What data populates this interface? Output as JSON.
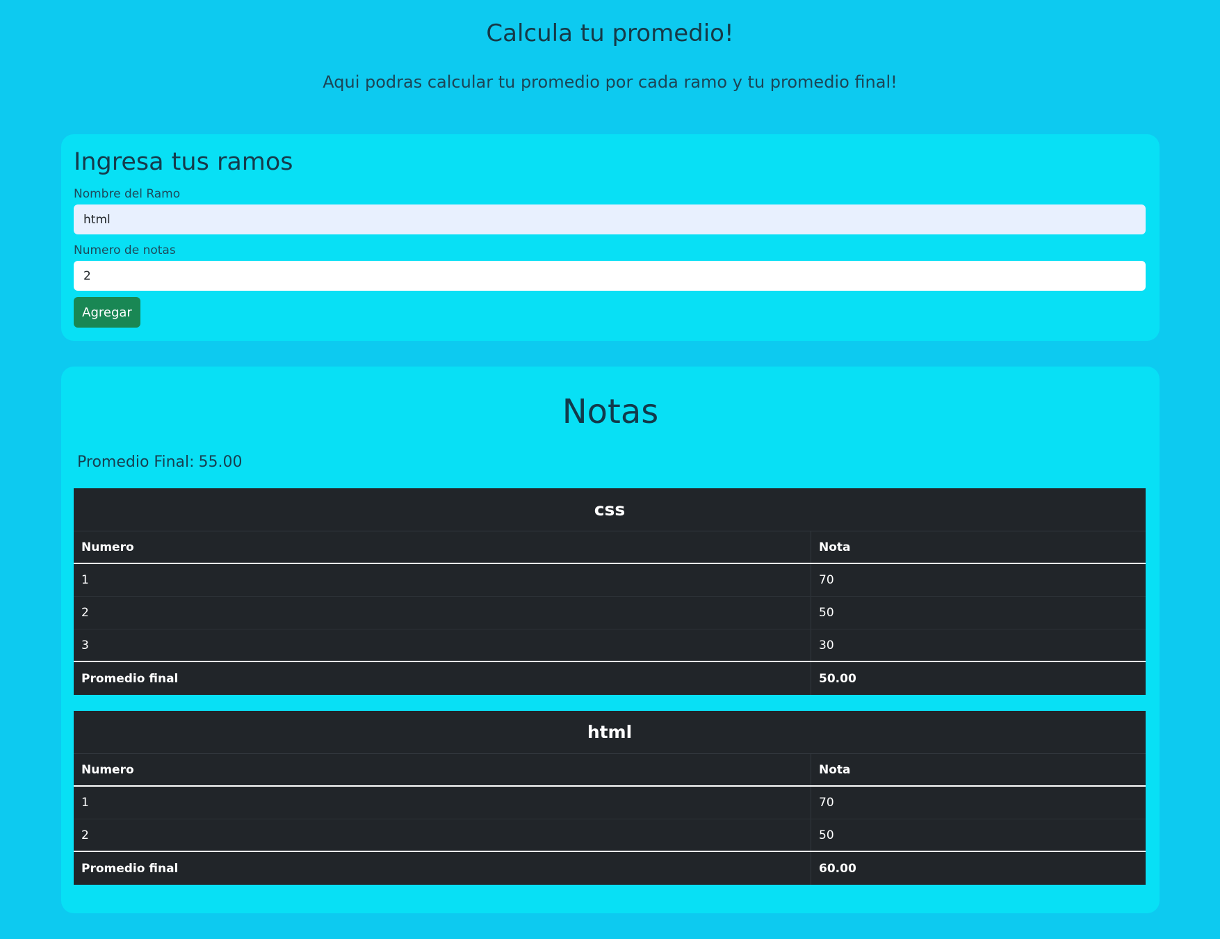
{
  "header": {
    "title": "Calcula tu promedio!",
    "subtitle": "Aqui podras calcular tu promedio por cada ramo y tu promedio final!"
  },
  "form": {
    "heading": "Ingresa tus ramos",
    "ramo_label": "Nombre del Ramo",
    "ramo_value": "html",
    "notas_label": "Numero de notas",
    "notas_value": "2",
    "submit_label": "Agregar"
  },
  "notas": {
    "heading": "Notas",
    "promedio_final_label": "Promedio Final:",
    "promedio_final_value": "55.00",
    "tables": [
      {
        "name": "css",
        "col_numero": "Numero",
        "col_nota": "Nota",
        "rows": [
          {
            "numero": "1",
            "nota": "70"
          },
          {
            "numero": "2",
            "nota": "50"
          },
          {
            "numero": "3",
            "nota": "30"
          }
        ],
        "footer_label": "Promedio final",
        "footer_value": "50.00"
      },
      {
        "name": "html",
        "col_numero": "Numero",
        "col_nota": "Nota",
        "rows": [
          {
            "numero": "1",
            "nota": "70"
          },
          {
            "numero": "2",
            "nota": "50"
          }
        ],
        "footer_label": "Promedio final",
        "footer_value": "60.00"
      }
    ]
  },
  "colors": {
    "background": "#0dcaf0",
    "card": "#08e0f5",
    "button": "#198754",
    "table": "#212529"
  }
}
